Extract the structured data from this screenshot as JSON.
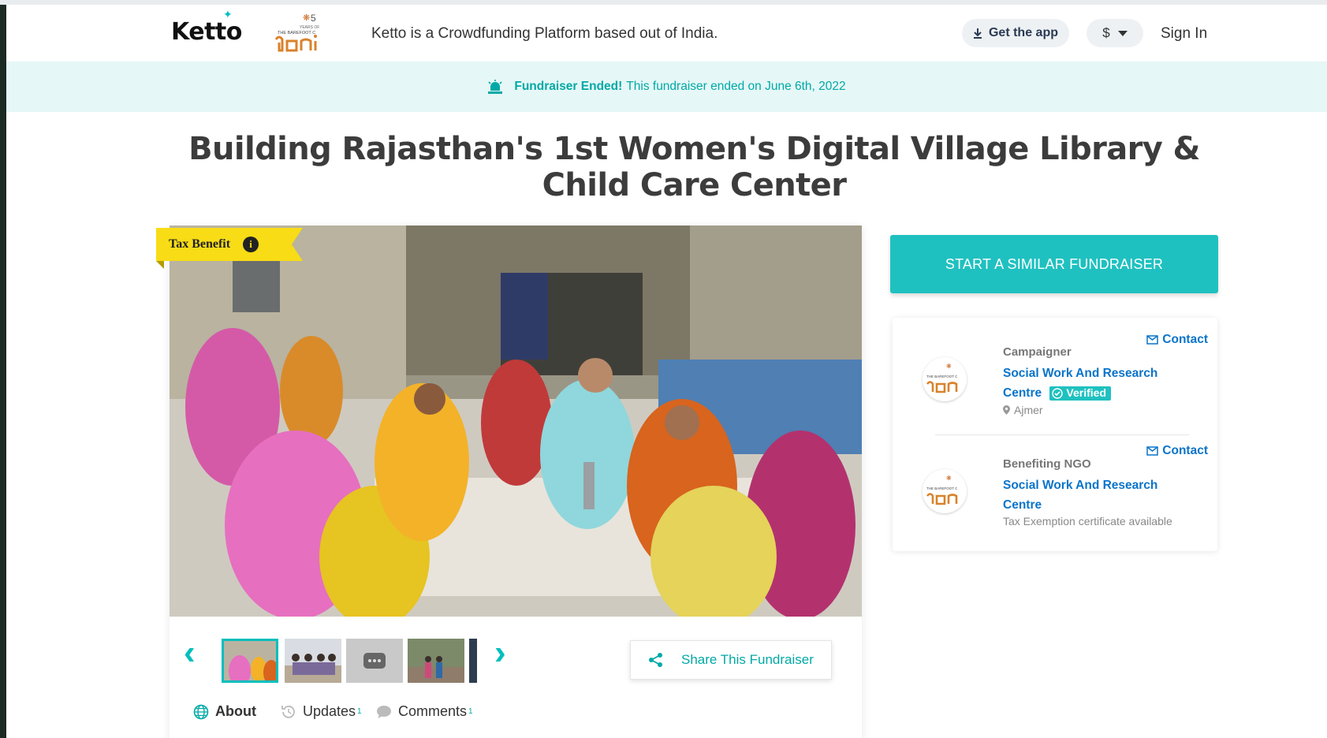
{
  "header": {
    "logo_text": "Ketto",
    "partner_logo_text": "THE BAREFOOT C",
    "partner_years": "5",
    "partner_years_label": "YEARS OF",
    "tagline": "Ketto is a Crowdfunding Platform based out of India.",
    "get_app_label": "Get the app",
    "currency_label": "$",
    "sign_in_label": "Sign In"
  },
  "banner": {
    "status_label": "Fundraiser Ended!",
    "status_text": "This fundraiser ended on June 6th, 2022"
  },
  "campaign": {
    "title": "Building Rajasthan's 1st Women's Digital Village Library & Child Care Center",
    "tax_badge": "Tax Benefit",
    "tax_info_icon": "i",
    "share_label": "Share This Fundraiser"
  },
  "tabs": [
    {
      "label": "About",
      "count": ""
    },
    {
      "label": "Updates",
      "count": "1"
    },
    {
      "label": "Comments",
      "count": "1"
    }
  ],
  "sidebar": {
    "cta_label": "START A SIMILAR FUNDRAISER",
    "campaigner": {
      "role": "Campaigner",
      "org_line1": "Social Work And Research",
      "org_line2": "Centre",
      "verified_label": "Verified",
      "location": "Ajmer",
      "contact_label": "Contact"
    },
    "ngo": {
      "role": "Benefiting NGO",
      "org_line1": "Social Work And Research",
      "org_line2": "Centre",
      "note": "Tax Exemption certificate available",
      "contact_label": "Contact"
    }
  },
  "colors": {
    "accent": "#1fc1c0",
    "link": "#0a74c9",
    "banner_bg": "#e5f7f6",
    "tax_badge": "#f7dc16"
  },
  "icons": [
    "download-icon",
    "caret-down-icon",
    "alarm-icon",
    "info-icon",
    "chevron-left-icon",
    "chevron-right-icon",
    "share-icon",
    "globe-icon",
    "history-icon",
    "comment-icon",
    "mail-icon",
    "check-circle-icon",
    "location-pin-icon"
  ]
}
